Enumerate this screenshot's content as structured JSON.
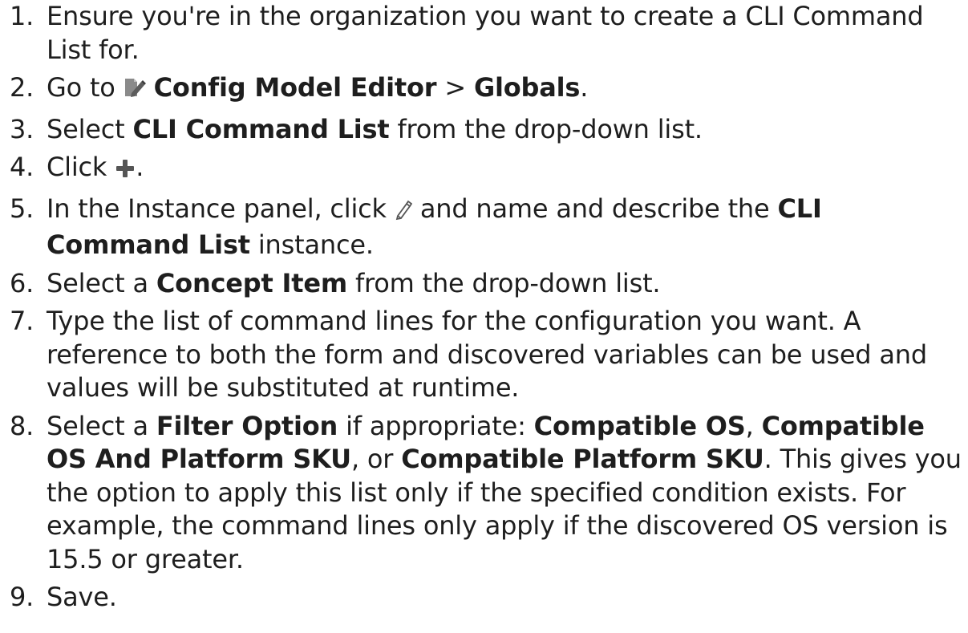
{
  "steps": [
    {
      "number": "1.",
      "text_1": "Ensure you're in the organization you want to create a CLI Command List for."
    },
    {
      "number": "2.",
      "text_1": "Go to ",
      "bold_1": "Config Model Editor",
      "text_2": " > ",
      "bold_2": "Globals",
      "text_3": ".",
      "icon": "config-model-editor-icon"
    },
    {
      "number": "3.",
      "text_1": "Select ",
      "bold_1": "CLI Command List",
      "text_2": " from the drop-down list."
    },
    {
      "number": "4.",
      "text_1": "Click ",
      "text_2": ".",
      "icon": "plus-icon"
    },
    {
      "number": "5.",
      "text_1": "In the Instance panel, click ",
      "text_2": " and name and describe the ",
      "bold_1": "CLI Command List",
      "text_3": " instance.",
      "icon": "pencil-icon"
    },
    {
      "number": "6.",
      "text_1": "Select a ",
      "bold_1": "Concept Item",
      "text_2": " from the drop-down list."
    },
    {
      "number": "7.",
      "text_1": "Type the list of command lines for the configuration you want.  A reference to both the form and discovered variables can be used and values will be substituted at runtime."
    },
    {
      "number": "8.",
      "text_1": "Select a ",
      "bold_1": "Filter Option",
      "text_2": " if appropriate: ",
      "bold_2": "Compatible OS",
      "text_3": ", ",
      "bold_3": "Compatible OS And Platform SKU",
      "text_4": ", or ",
      "bold_4": "Compatible Platform SKU",
      "text_5": ". This gives you the option to apply this list only if the specified condition exists. For example, the command lines only apply if the discovered OS version is 15.5 or greater."
    },
    {
      "number": "9.",
      "text_1": "Save."
    }
  ],
  "colors": {
    "text": "#1e1e1e",
    "icon_gray": "#7a7a7a",
    "icon_dark": "#555555"
  }
}
